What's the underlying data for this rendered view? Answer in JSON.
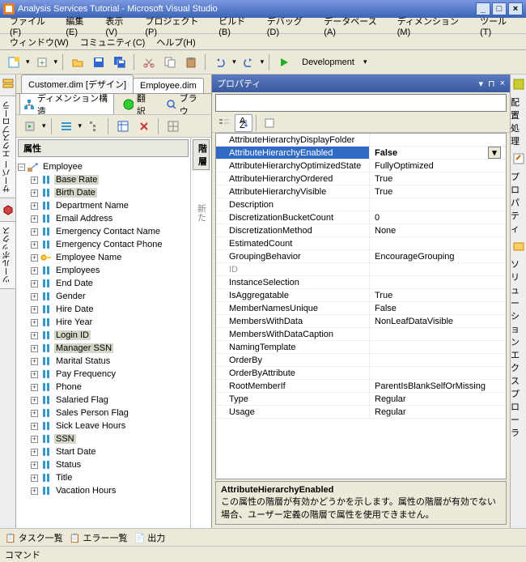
{
  "window": {
    "title": "Analysis Services Tutorial - Microsoft Visual Studio"
  },
  "menu": {
    "file": "ファイル(F)",
    "edit": "編集(E)",
    "view": "表示(V)",
    "project": "プロジェクト(P)",
    "build": "ビルド(B)",
    "debug": "デバッグ(D)",
    "database": "データベース(A)",
    "dimension": "ディメンション(M)",
    "tools": "ツール(T)",
    "window": "ウィンドウ(W)",
    "community": "コミュニティ(C)",
    "help": "ヘルプ(H)"
  },
  "toolbar": {
    "config": "Development"
  },
  "tabs": {
    "customer": "Customer.dim [デザイン]",
    "employee": "Employee.dim"
  },
  "subtabs": {
    "structure": "ディメンション構造",
    "translation": "翻訳",
    "browse": "ブラウ"
  },
  "panes": {
    "attributes": "属性",
    "hierarchies": "階層",
    "hier_hint": "新た"
  },
  "tree": {
    "root": "Employee",
    "items": [
      "Base Rate",
      "Birth Date",
      "Department Name",
      "Email Address",
      "Emergency Contact Name",
      "Emergency Contact Phone",
      "Employee Name",
      "Employees",
      "End Date",
      "Gender",
      "Hire Date",
      "Hire Year",
      "Login ID",
      "Manager SSN",
      "Marital Status",
      "Pay Frequency",
      "Phone",
      "Salaried Flag",
      "Sales Person Flag",
      "Sick Leave Hours",
      "SSN",
      "Start Date",
      "Status",
      "Title",
      "Vacation Hours"
    ],
    "highlight": [
      "Base Rate",
      "Birth Date",
      "Login ID",
      "Manager SSN",
      "SSN"
    ],
    "key_icon": [
      "Employee Name"
    ]
  },
  "properties": {
    "title": "プロパティ",
    "rows": [
      {
        "n": "AttributeHierarchyDisplayFolder",
        "v": ""
      },
      {
        "n": "AttributeHierarchyEnabled",
        "v": "False",
        "sel": true
      },
      {
        "n": "AttributeHierarchyOptimizedState",
        "v": "FullyOptimized"
      },
      {
        "n": "AttributeHierarchyOrdered",
        "v": "True"
      },
      {
        "n": "AttributeHierarchyVisible",
        "v": "True"
      },
      {
        "n": "Description",
        "v": ""
      },
      {
        "n": "DiscretizationBucketCount",
        "v": "0"
      },
      {
        "n": "DiscretizationMethod",
        "v": "None"
      },
      {
        "n": "EstimatedCount",
        "v": ""
      },
      {
        "n": "GroupingBehavior",
        "v": "EncourageGrouping"
      },
      {
        "n": "ID",
        "v": "",
        "dis": true
      },
      {
        "n": "InstanceSelection",
        "v": ""
      },
      {
        "n": "IsAggregatable",
        "v": "True"
      },
      {
        "n": "MemberNamesUnique",
        "v": "False"
      },
      {
        "n": "MembersWithData",
        "v": "NonLeafDataVisible"
      },
      {
        "n": "MembersWithDataCaption",
        "v": ""
      },
      {
        "n": "NamingTemplate",
        "v": ""
      },
      {
        "n": "OrderBy",
        "v": ""
      },
      {
        "n": "OrderByAttribute",
        "v": ""
      },
      {
        "n": "RootMemberIf",
        "v": "ParentIsBlankSelfOrMissing"
      },
      {
        "n": "Type",
        "v": "Regular"
      },
      {
        "n": "Usage",
        "v": "Regular"
      }
    ],
    "desc_title": "AttributeHierarchyEnabled",
    "desc_body": "この属性の階層が有効かどうかを示します。属性の階層が有効でない場合、ユーザー定義の階層で属性を使用できません。"
  },
  "side": {
    "server": "サーバー エクスプローラ",
    "toolbox": "ツールボックス",
    "deploy": "配置処理",
    "props": "プロパティ",
    "solution": "ソリューション エクスプローラ"
  },
  "bottom": {
    "tasklist": "タスク一覧",
    "errorlist": "エラー一覧",
    "output": "出力"
  },
  "status": {
    "text": "コマンド"
  }
}
